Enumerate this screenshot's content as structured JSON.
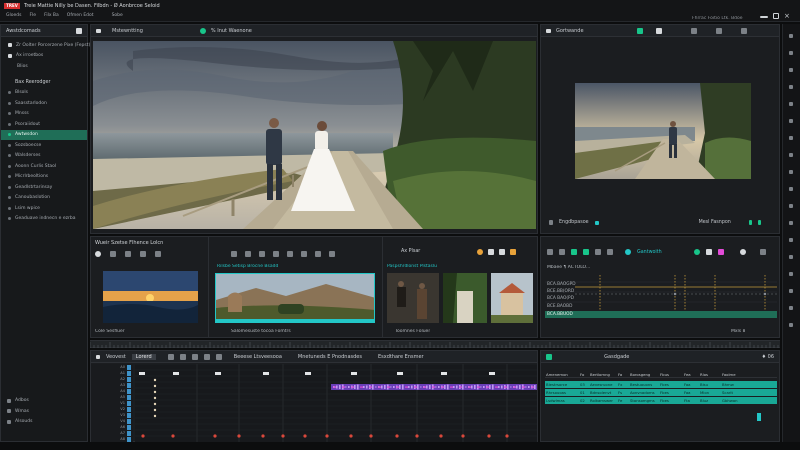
{
  "titlebar": {
    "badge": "TREV",
    "title": "Treie Mattie Nilly be Dasen.  Filbdn - Ø Aonbrcoe  Seloid",
    "menu": [
      "Gloeds",
      "Fle",
      "Filx Ba",
      "Ofmen Edot",
      "Sobe"
    ],
    "right_text": "Fhrrac Foitio Ltk. Bdoe",
    "window_controls": [
      "minimize-icon",
      "maximize-icon",
      "close-icon"
    ]
  },
  "sidebar": {
    "header": "Awstdcomads",
    "project_lines": [
      "Zr Oolter Porcerzene Pixe (Fepst)",
      "Ax irroetbos",
      "Blios"
    ],
    "section_label": "Bax Reerodger",
    "items": [
      {
        "label": "Blsols",
        "active": false
      },
      {
        "label": "Saasstarlodon",
        "active": false
      },
      {
        "label": "Mnsss",
        "active": false
      },
      {
        "label": "Psoraiidout",
        "active": false
      },
      {
        "label": "Awtwsdon",
        "active": true
      },
      {
        "label": "Sozsboecse",
        "active": false
      },
      {
        "label": "Walsderses",
        "active": false
      },
      {
        "label": "Aoonn Curlis Staol",
        "active": false
      },
      {
        "label": "Micrlrbeoltions",
        "active": false
      },
      {
        "label": "Geadlstrtarinsay",
        "active": false
      },
      {
        "label": "Canoubaslotion",
        "active": false
      },
      {
        "label": "Lsim wpice",
        "active": false
      },
      {
        "label": "Geaduave indnecn e ezrba",
        "active": false
      }
    ],
    "footer_items": [
      "Adbos",
      "Wmas",
      "Alsouds"
    ]
  },
  "viewer": {
    "tab1": "Mstewntting",
    "tab2": "% Inut Waenone"
  },
  "program": {
    "title": "Gortwande",
    "footer_left": "Engdbpasoe",
    "footer_right": "Mesl Fasnpon"
  },
  "browser": {
    "title": "Wueir Szetse Flhence Lolcn",
    "clips": [
      {
        "label": "Cole Sesfluer"
      },
      {
        "label": "Salomesuste tocoa Fomtrs"
      },
      {
        "label": "Toomnes Foluer"
      }
    ],
    "selected_label": "Rilsbe Setisp Brocne Bsadd",
    "selected_label2": "Paspshrdlonst Plstaslu"
  },
  "effects": {
    "title": "Ax Plsar",
    "scope_label": "Gantwoith",
    "readout": "Mbaee ¶ ACTOLO...",
    "rows": [
      "BCA.BAOGPD",
      "BCE.BB(ORD",
      "BCA BAO(PD",
      "BCE.BAOBD"
    ],
    "active_row": "BCA.BBUOD",
    "footer": "Mxls 8"
  },
  "timeline": {
    "tools": [
      "Veovest",
      "Lorerd"
    ],
    "tabs": [
      "Beeese Ltsveesooa",
      "Mnetuneds E Pnodnasdes",
      "Esxdthare Ensmer"
    ],
    "track_labels": [
      "A0",
      "A1",
      "A2",
      "A3",
      "A4",
      "A5",
      "V1",
      "V2",
      "V3",
      "V4",
      "A6",
      "A7",
      "A8"
    ]
  },
  "inspector": {
    "title": "Gasdgade",
    "counter": "♦ 06",
    "columns": [
      "Amenemon",
      "Fo",
      "Bertlomng",
      "Fa",
      "Borosgeng",
      "Fbus",
      "Fea",
      "Rlos",
      "Faolme"
    ],
    "rows": [
      [
        "Blestrsorce",
        "03",
        "Aevesruone",
        "Fx",
        "Bestuouons",
        "Fbes",
        "Faa",
        "Bisu",
        "Bhmw"
      ],
      [
        "Rhrsouoas",
        "01",
        "Bdnsolenvt",
        "Fs",
        "Aonvnadoms",
        "Fbes",
        "Faa",
        "Mlon",
        "Scarlt"
      ],
      [
        "Lsdwlmas",
        "02",
        "Rolkamswer",
        "Fe",
        "Stonsomgms",
        "Fbes",
        "Fta",
        "Bluz",
        "Gbhwon"
      ]
    ]
  },
  "colors": {
    "accent_green": "#18c58a",
    "accent_teal": "#23c7c7",
    "accent_purple": "#8f5ae0",
    "accent_orange": "#e8a23a",
    "accent_red": "#d9483b"
  }
}
